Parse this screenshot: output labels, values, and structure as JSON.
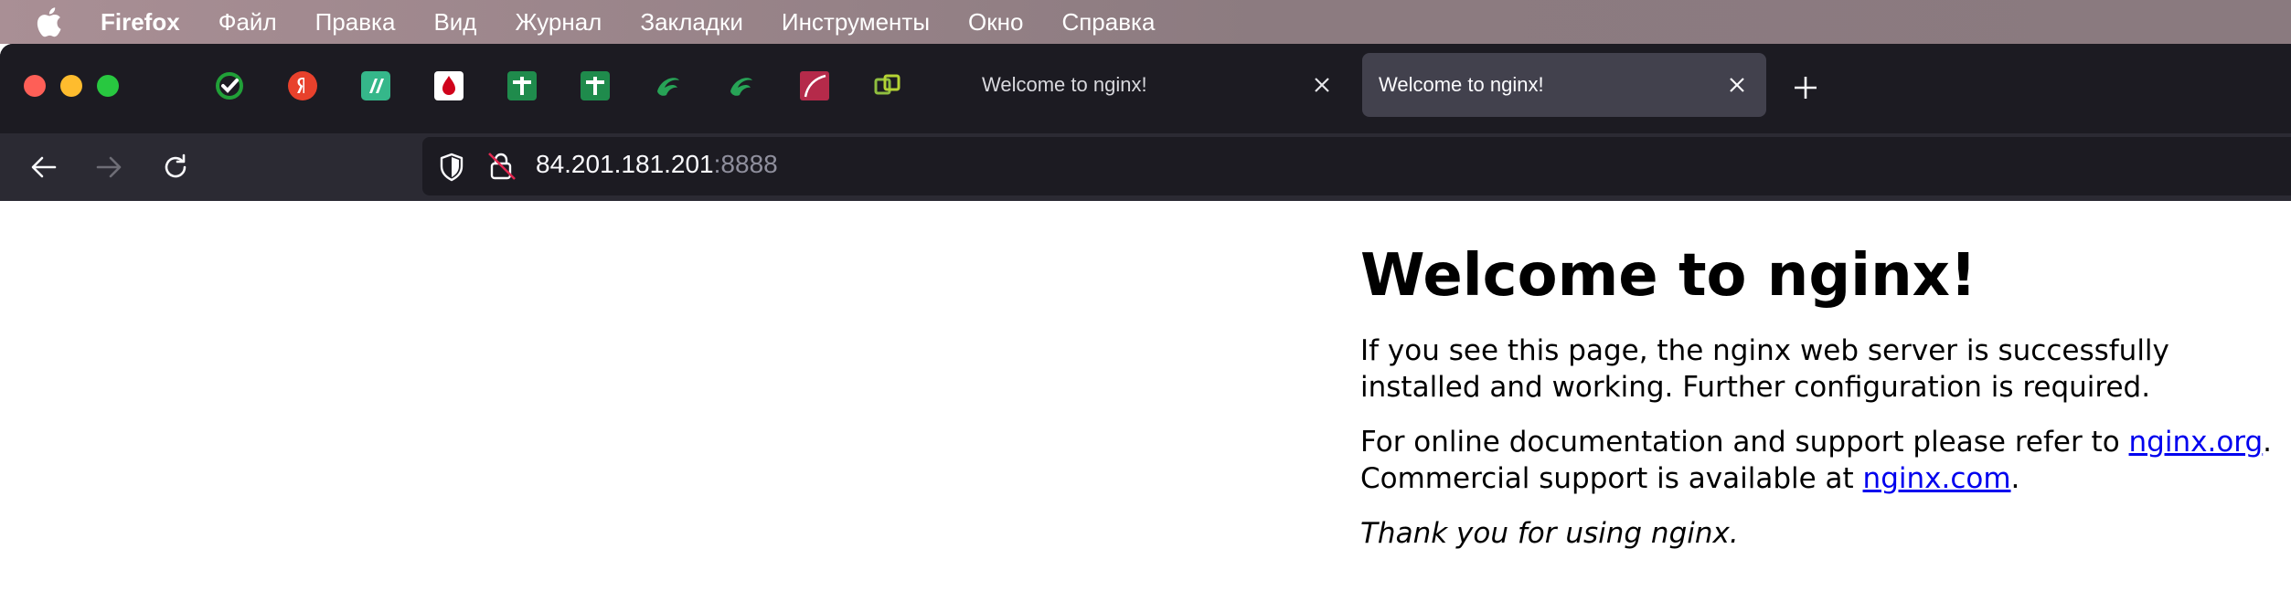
{
  "menubar": {
    "app_name": "Firefox",
    "items": [
      "Файл",
      "Правка",
      "Вид",
      "Журнал",
      "Закладки",
      "Инструменты",
      "Окно",
      "Справка"
    ]
  },
  "pinned_tabs": [
    {
      "icon": "sber-check-icon",
      "color": "#ffffff"
    },
    {
      "icon": "yandex-icon",
      "color": "#e8412c"
    },
    {
      "icon": "stroke-app-icon",
      "color": "#35b78a"
    },
    {
      "icon": "red-drop-icon",
      "color": "#ffffff"
    },
    {
      "icon": "green-table-icon",
      "color": "#1f8b4c"
    },
    {
      "icon": "green-table-icon",
      "color": "#1f8b4c"
    },
    {
      "icon": "green-swirl-icon",
      "color": "#27a356"
    },
    {
      "icon": "green-swirl-icon",
      "color": "#27a356"
    },
    {
      "icon": "red-curve-icon",
      "color": "#b52a4a"
    },
    {
      "icon": "vmware-icon",
      "color": "#8fbe3f"
    }
  ],
  "tabs": [
    {
      "title": "Welcome to nginx!",
      "active": false
    },
    {
      "title": "Welcome to nginx!",
      "active": true
    }
  ],
  "navbar": {
    "url_host": "84.201.181.201",
    "url_port": ":8888"
  },
  "page": {
    "heading": "Welcome to nginx!",
    "para1": "If you see this page, the nginx web server is successfully installed and working. Further configuration is required.",
    "para2_prefix": "For online documentation and support please refer to ",
    "link_org": "nginx.org",
    "para2_mid": ".",
    "para2_line2": "Commercial support is available at ",
    "link_com": "nginx.com",
    "para2_end": ".",
    "thanks": "Thank you for using nginx."
  },
  "colors": {
    "tabstrip_bg": "#1c1b22",
    "navbar_bg": "#2b2a33",
    "active_tab_bg": "#42414d",
    "link": "#0000ee"
  }
}
